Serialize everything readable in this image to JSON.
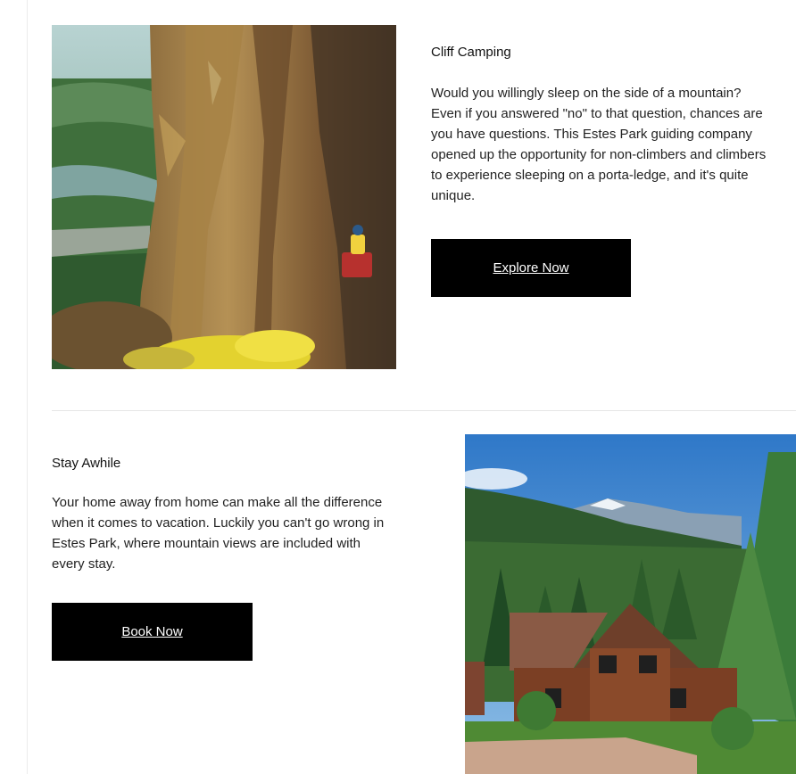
{
  "cards": [
    {
      "title": "Cliff Camping",
      "body_lines": [
        "Would you willingly sleep on the side of a mountain?",
        "Even if you answered \"no\" to that question, chances are",
        "you have questions. This Estes Park guiding company",
        "opened up the opportunity for non-climbers and climbers",
        "to experience sleeping on a porta-ledge, and it's quite",
        "unique."
      ],
      "button_label": "Explore Now",
      "image": "cliff-climber-photo"
    },
    {
      "title": "Stay Awhile",
      "body_lines": [
        "Your home away from home can make all the difference",
        "when it comes to vacation. Luckily you can't go wrong in",
        "Estes Park, where mountain views are included with",
        "every stay."
      ],
      "button_label": "Book Now",
      "image": "mountain-lodge-photo"
    }
  ],
  "colors": {
    "button_bg": "#000000",
    "button_text": "#ffffff",
    "divider": "#e6e6e6"
  }
}
